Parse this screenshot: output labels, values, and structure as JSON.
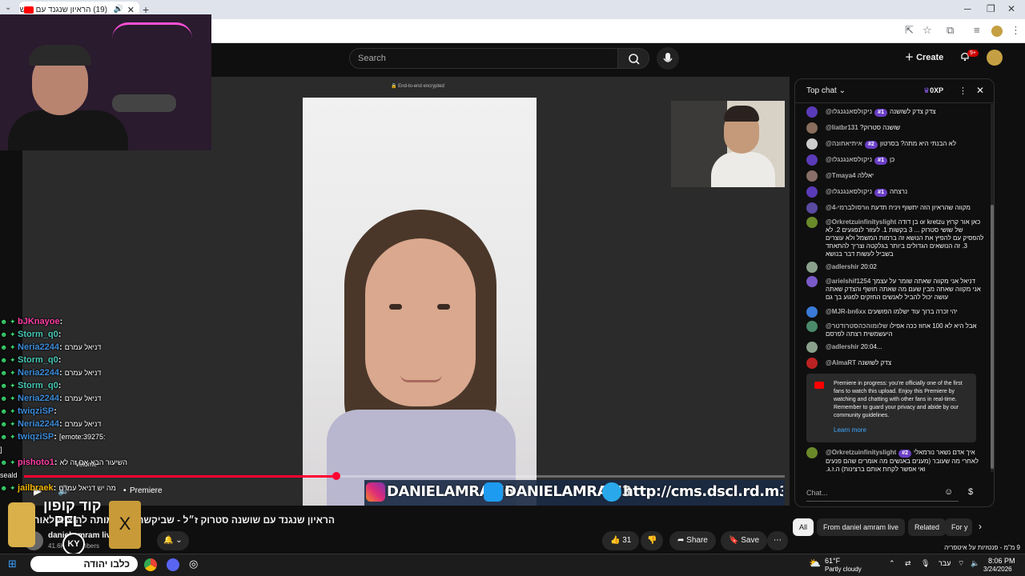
{
  "browser": {
    "tab_title": "(19) הראיון שנגנד עם שושנה",
    "tab_close": "✕",
    "new_tab": "+"
  },
  "header": {
    "search_placeholder": "Search",
    "create_label": "Create",
    "notif_count": "9+"
  },
  "player": {
    "e2e_label": "End-to-end encrypted",
    "handles": [
      "DANIELAMRAM6",
      "DANIELAMRAM3",
      "http://cms.dscl.rd.m3"
    ],
    "premiere_label": "Premiere",
    "volume_label": "Volume",
    "progress_fraction": 0.41
  },
  "video": {
    "title": "הראיון שנגנד עם שושנה סטרוק ז״ל - שביקשה לפני מותה להוציא לאור את הסיפור המלא",
    "channel": "daniel amram live",
    "subs": "41.6K subscribers",
    "likes": "31",
    "share_label": "Share",
    "save_label": "Save"
  },
  "chat": {
    "header": "Top chat",
    "xp": "0XP",
    "input_placeholder": "Chat...",
    "messages": [
      {
        "author": "@ניקולסאנגנגלו",
        "rank": "#1",
        "text": "צדק צדק לשושנה",
        "avatar_color": "#5a3ab8"
      },
      {
        "author": "@liatbr131",
        "rank": "",
        "text": "שושנה סטרוק?",
        "avatar_color": "#8a6d5c"
      },
      {
        "author": "@איתיאחונה",
        "rank": "#2",
        "text": "לא הבנתי היא מתה? בסרטון",
        "avatar_color": "#cccccc"
      },
      {
        "author": "@ניקולסאנגנגלו",
        "rank": "#1",
        "text": "כן",
        "avatar_color": "#5a3ab8"
      },
      {
        "author": "@Tmaya4",
        "rank": "",
        "text": "יאללה",
        "avatar_color": "#8a6f68"
      },
      {
        "author": "@ניקולסאנגנגלו",
        "rank": "#1",
        "text": "נרצחה",
        "avatar_color": "#5a3ab8"
      },
      {
        "author": "@רסולברמי-4n",
        "rank": "",
        "text": "מקווה שהראיון הזה יתשוף ויניח תדעת",
        "avatar_color": "#5a4aa0"
      },
      {
        "author": "@Orkretzuinfinityslight",
        "rank": "",
        "text": "כאן אור קרוץ or kretzu בן דודה של שושי סטרוק ... 3 בקשות 1. לעזור לנפגעים 2. לא להפסיק עם להפיץ את הנושא זה ברמות המשמל ולא עוצרים 3. זה הנושאים הגדולים ביותר בגלקטה וצריך להתאחד בשביל לעשות דבר בנושא",
        "avatar_color": "#6a8a2a"
      },
      {
        "author": "@adlershir",
        "rank": "",
        "text": "20:02",
        "avatar_color": "#8aa08a"
      },
      {
        "author": "@arielshif1254",
        "rank": "",
        "text": "דניאל אני מקווה שאתה שומר על עצמך אני מקווה שאתה מבין שעם מה שאתה חושף והצדק שאתה עושה יכול להביל לאנשים החזקים לפגוע בך גם",
        "avatar_color": "#7a5ac8"
      },
      {
        "author": "@MJR-bn6xx",
        "rank": "",
        "text": "יהי זכרה ברוך עוד ישלמו הפושעים",
        "avatar_color": "#3a7ad8"
      },
      {
        "author": "@שלומוהכהסטרודטר",
        "rank": "",
        "text": "אבל היא לא 100 אחוז ככה אפילו היעשמשית רצתה לפרסם",
        "avatar_color": "#4a8a6a"
      },
      {
        "author": "@adlershir",
        "rank": "",
        "text": "20:04...",
        "avatar_color": "#8aa08a"
      },
      {
        "author": "@AlmaRT",
        "rank": "",
        "text": "צדק לשושנה",
        "avatar_color": "#b22"
      },
      {
        "author": "@Orkretzuinfinityslight",
        "rank": "#2",
        "text": "איך אדם נשאר נורמאלי לאחרי מה שעובר (מענים באנשים מה אומרים שהם פנעים ואי אפשר לקחת אותם ברצינות) ה.ז.ג.",
        "avatar_color": "#6a8a2a"
      }
    ],
    "premiere_notice": "Premiere in progress: you're officially one of the first fans to watch this upload. Enjoy this Premiere by watching and chatting with other fans in real-time. Remember to guard your privacy and abide by our community guidelines.",
    "learn_more": "Learn more"
  },
  "chips": [
    "All",
    "From daniel amram live",
    "Related",
    "For y"
  ],
  "twitch_chat": [
    {
      "user": "bJKnayoe",
      "msg": "",
      "color": "p"
    },
    {
      "user": "Storm_q0",
      "msg": "",
      "color": "g"
    },
    {
      "user": "Neria2244",
      "msg": "דניאל עמרם",
      "color": ""
    },
    {
      "user": "Storm_q0",
      "msg": "",
      "color": "g"
    },
    {
      "user": "Neria2244",
      "msg": "דניאל עמרם",
      "color": ""
    },
    {
      "user": "Storm_q0",
      "msg": "",
      "color": "g"
    },
    {
      "user": "Neria2244",
      "msg": "דניאל עמרם",
      "color": ""
    },
    {
      "user": "twiqziSP",
      "msg": "",
      "color": ""
    },
    {
      "user": "Neria2244",
      "msg": "דניאל עמרם",
      "color": ""
    },
    {
      "user": "twiqziSP",
      "msg": "[emote:39275:",
      "color": ""
    },
    {
      "user": "",
      "msg": "]",
      "color": ""
    },
    {
      "user": "pishoto1",
      "msg": "השיעור הבא אם זה לא",
      "color": "p"
    },
    {
      "user": "",
      "msg": "seald",
      "color": ""
    },
    {
      "user": "jailbraek",
      "msg": "מה יש דניאל עמרם",
      "color": "y"
    }
  ],
  "promo": {
    "top": "קוד קופון",
    "code": "PFL",
    "bottom": "כלבו יהודה",
    "logo": "KY"
  },
  "taskbar": {
    "weather_temp": "61°F",
    "weather_desc": "Partly cloudy",
    "time": "8:06 PM",
    "date": "3/24/2026",
    "lang": "עבר",
    "suggested_video": "9 מ\"מ - פנטזיות על איטפריה"
  },
  "colors": {
    "accent": "#ff0033",
    "rank_badge": "#6b3fc7",
    "bg": "#0f0f0f"
  }
}
